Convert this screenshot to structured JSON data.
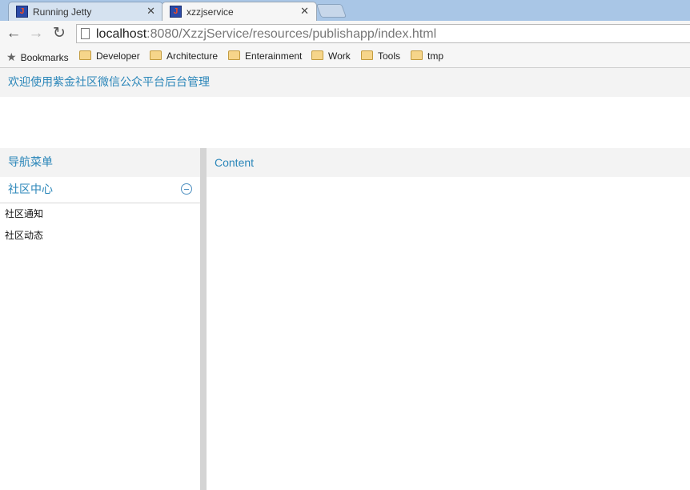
{
  "browser": {
    "tabs": [
      {
        "title": "Running Jetty",
        "favicon": "jetty-icon"
      },
      {
        "title": "xzzjservice",
        "favicon": "jetty-icon"
      }
    ],
    "url_host": "localhost",
    "url_rest": ":8080/XzzjService/resources/publishapp/index.html",
    "bookmarks_label": "Bookmarks",
    "bookmark_folders": [
      "Developer",
      "Architecture",
      "Enterainment",
      "Work",
      "Tools",
      "tmp"
    ]
  },
  "page": {
    "header_title": "欢迎使用紫金社区微信公众平台后台管理",
    "west": {
      "title": "导航菜单",
      "accordion": {
        "title": "社区中心",
        "items": [
          "社区通知",
          "社区动态"
        ]
      }
    },
    "center": {
      "title": "Content"
    }
  },
  "colors": {
    "accent_text": "#2a86b9",
    "panel_header_bg": "#f3f3f3",
    "tabstrip_bg": "#a9c6e6"
  }
}
